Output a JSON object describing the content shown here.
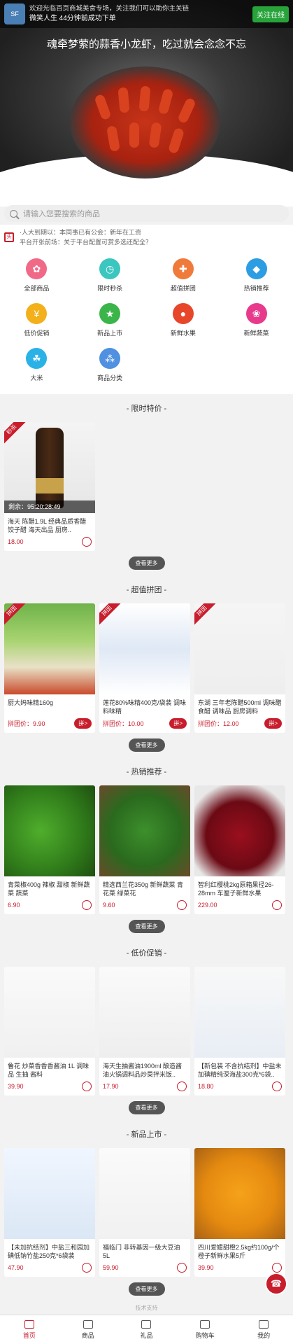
{
  "notice": {
    "avatar_text": "SF",
    "line1": "欢迎光临百页商城美食专场，关注我们可以助你主关链",
    "line2": "微笑人生",
    "line2b": "44分钟前成功下单",
    "follow": "关注在线"
  },
  "hero": {
    "slogan": "魂牵梦萦的蒜香小龙虾，吃过就会念念不忘"
  },
  "search": {
    "placeholder": "请输入您要搜索的商品"
  },
  "news": {
    "line1": "·人大到期以：本同事已有公会：新年在工资",
    "line2": "平台开张前场：关于平台配置可赏多选还配全？"
  },
  "nav": [
    {
      "label": "全部商品",
      "color": "#f06a87",
      "icon": "shop-icon",
      "glyph": "✿"
    },
    {
      "label": "限时秒杀",
      "color": "#3cc6c0",
      "icon": "clock-icon",
      "glyph": "◷"
    },
    {
      "label": "超值拼团",
      "color": "#f07a3a",
      "icon": "group-icon",
      "glyph": "✚"
    },
    {
      "label": "热销推荐",
      "color": "#2d9de3",
      "icon": "hot-icon",
      "glyph": "◆"
    },
    {
      "label": "低价促销",
      "color": "#f3b01a",
      "icon": "price-icon",
      "glyph": "¥"
    },
    {
      "label": "新品上市",
      "color": "#3bb54a",
      "icon": "new-icon",
      "glyph": "★"
    },
    {
      "label": "新鲜水果",
      "color": "#e8462a",
      "icon": "fruit-icon",
      "glyph": "●"
    },
    {
      "label": "新鲜蔬菜",
      "color": "#e83a8c",
      "icon": "vegetable-icon",
      "glyph": "❀"
    },
    {
      "label": "大米",
      "color": "#2ab2e6",
      "icon": "rice-icon",
      "glyph": "☘"
    },
    {
      "label": "商品分类",
      "color": "#4f90e0",
      "icon": "category-icon",
      "glyph": "⁂"
    }
  ],
  "sections": {
    "flash": {
      "title": "- 限时特价 -",
      "more": "查看更多",
      "tag": "秒杀",
      "timer_label": "剩余：",
      "timer": "95:20:28:49",
      "product": {
        "name": "海天 陈醋1.9L 经典品质香醋 饺子醋 海天出品 厨房..",
        "price": "18.00"
      }
    },
    "group": {
      "title": "- 超值拼团 -",
      "more": "查看更多",
      "tag": "拼团",
      "button": "拼>",
      "products": [
        {
          "name": "厨大妈味精160g",
          "price": "拼团价：9.90"
        },
        {
          "name": "莲花80%味精400克/袋装 调味料味精",
          "price": "拼团价：10.00"
        },
        {
          "name": "东湖 三年老陈醋500ml 调味醋 食醋 调味品 厨房调料",
          "price": "拼团价：12.00"
        }
      ]
    },
    "hot": {
      "title": "- 热销推荐 -",
      "more": "查看更多",
      "products": [
        {
          "name": "青菜椒400g 辣椒 甜椒 新鲜蔬菜 蔬菜",
          "price": "6.90"
        },
        {
          "name": "精选西兰花350g 新鲜蔬菜 青花菜 绿菜花",
          "price": "9.60"
        },
        {
          "name": "智利红樱桃2kg原箱果径26-28mm 车厘子新鲜水果",
          "price": "229.00"
        }
      ]
    },
    "promo": {
      "title": "- 低价促销 -",
      "more": "查看更多",
      "products": [
        {
          "name": "鲁花 炒菜香香香酱油 1L 调味品 生抽 酱料",
          "price": "39.90"
        },
        {
          "name": "海天生抽酱油1900ml 酿造酱油火锅调料品炒菜拌米饭..",
          "price": "17.90"
        },
        {
          "name": "【新包装 不含抗结剂】中盐未加碘精纯深海盐300克*6袋..",
          "price": "18.80"
        }
      ]
    },
    "newp": {
      "title": "- 新品上市 -",
      "more": "查看更多",
      "products": [
        {
          "name": "【未加抗结剂】中盐三和园加碘低钠竹盐250克*6袋装",
          "price": "47.90"
        },
        {
          "name": "福临门 非转基因一级大豆油5L",
          "price": "59.90"
        },
        {
          "name": "四川爱媛甜橙2.5kg约100g/个 橙子新鲜水果5斤",
          "price": "39.90"
        }
      ]
    }
  },
  "footer": {
    "brand": "技术支持",
    "chat_icon": "customer-service-icon"
  },
  "tabbar": [
    {
      "label": "首页",
      "icon": "home-icon",
      "active": true
    },
    {
      "label": "商品",
      "icon": "goods-icon",
      "active": false
    },
    {
      "label": "礼品",
      "icon": "gift-icon",
      "active": false
    },
    {
      "label": "购物车",
      "icon": "cart-icon",
      "active": false
    },
    {
      "label": "我的",
      "icon": "user-icon",
      "active": false
    }
  ]
}
